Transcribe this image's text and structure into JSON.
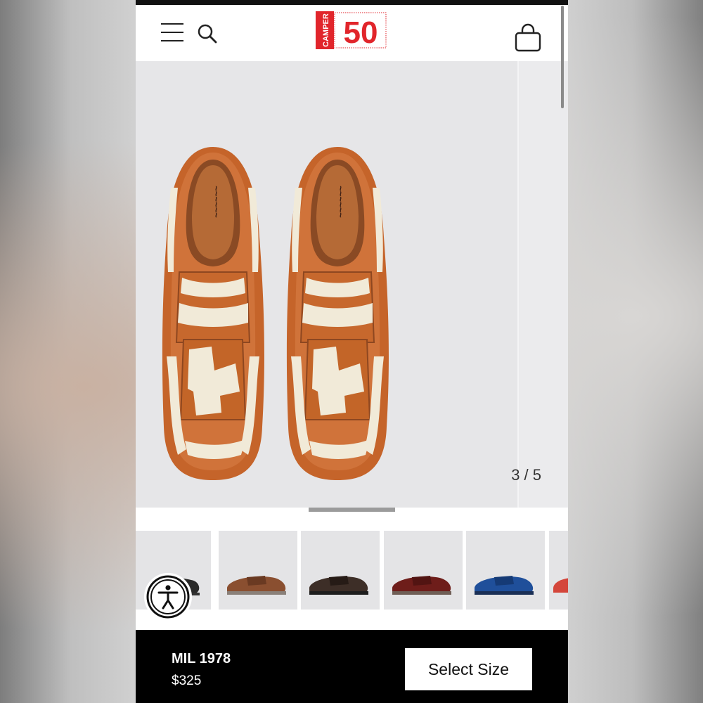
{
  "header": {
    "menu_icon": "hamburger-menu-icon",
    "search_icon": "search-icon",
    "logo_text": "CAMPER",
    "logo_number": "50",
    "bag_icon": "shopping-bag-icon",
    "brand_color": "#e1252b"
  },
  "gallery": {
    "counter": "3 / 5",
    "current": 3,
    "total": 5,
    "background": "#e6e6e8"
  },
  "thumbnails": [
    {
      "color": "#2a2a2a",
      "name": "black"
    },
    {
      "color": "#8a4f30",
      "name": "brown"
    },
    {
      "color": "#3d2e27",
      "name": "dark-brown"
    },
    {
      "color": "#6e1d1a",
      "name": "burgundy"
    },
    {
      "color": "#1f4f9a",
      "name": "blue"
    },
    {
      "color": "#d4463b",
      "name": "red"
    }
  ],
  "accessibility": {
    "icon": "accessibility-icon"
  },
  "product": {
    "name": "MIL 1978",
    "price": "$325",
    "cta": "Select Size"
  }
}
